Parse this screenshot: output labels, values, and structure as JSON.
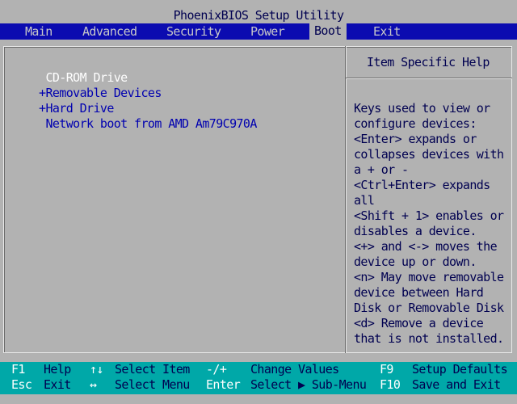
{
  "title": "PhoenixBIOS Setup Utility",
  "menu": [
    "Main",
    "Advanced",
    "Security",
    "Power",
    "Boot",
    "Exit"
  ],
  "active_menu": "Boot",
  "boot_list": [
    {
      "label": "CD-ROM Drive",
      "prefix": " ",
      "selected": true
    },
    {
      "label": "Removable Devices",
      "prefix": "+",
      "selected": false
    },
    {
      "label": "Hard Drive",
      "prefix": "+",
      "selected": false
    },
    {
      "label": "Network boot from AMD Am79C970A",
      "prefix": " ",
      "selected": false
    }
  ],
  "help": {
    "title": "Item Specific Help",
    "lines": [
      "Keys used to view or",
      "configure devices:",
      "<Enter> expands or",
      "collapses devices with",
      "a + or -",
      "<Ctrl+Enter> expands",
      "all",
      "<Shift + 1> enables or",
      "disables a device.",
      "<+> and <-> moves the",
      "device up or down.",
      "<n> May move removable",
      "device between Hard",
      "Disk or Removable Disk",
      "<d> Remove a device",
      "that is not installed."
    ]
  },
  "status": {
    "row1": {
      "k1": "F1",
      "d1": "Help",
      "k2": "↑↓",
      "d2": "Select Item",
      "k3": "-/+",
      "d3": "Change Values",
      "k4": "F9",
      "d4": "Setup Defaults"
    },
    "row2": {
      "k1": "Esc",
      "d1": "Exit",
      "k2": "↔",
      "d2": "Select Menu",
      "k3": "Enter",
      "d3": "Select ▶ Sub-Menu",
      "k4": "F10",
      "d4": "Save and Exit"
    }
  },
  "colors": {
    "menubar_bg": "#0b0bb0",
    "panel_bg": "#b2b2b2",
    "statusbar_bg": "#00a8a8",
    "boot_item": "#0000b0",
    "selected_item": "#ffffff"
  }
}
